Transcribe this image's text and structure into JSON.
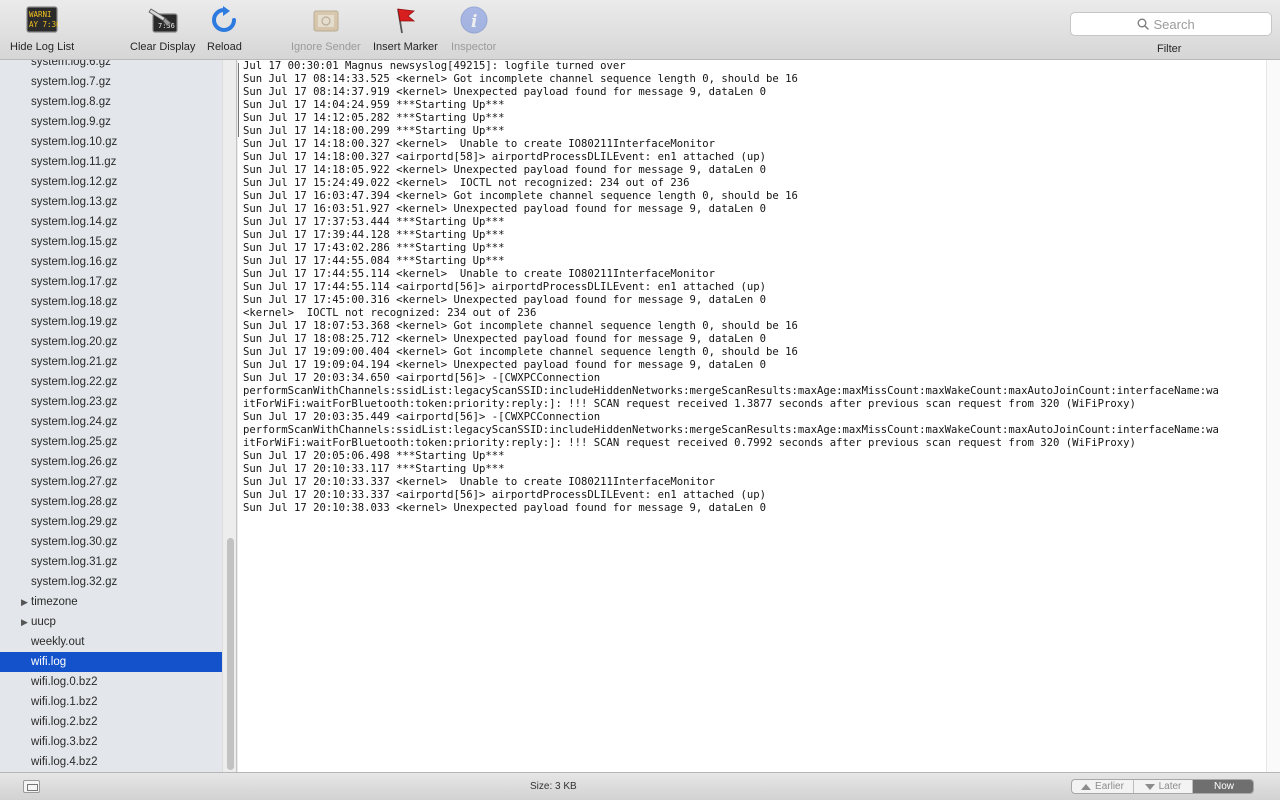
{
  "toolbar": {
    "hide_log_list": "Hide Log List",
    "hide_log_list_icon_text_top": "WARNI",
    "hide_log_list_icon_text_bottom": "AY 7:36",
    "clear_display": "Clear Display",
    "clear_display_icon_text": "7:36",
    "reload": "Reload",
    "ignore_sender": "Ignore Sender",
    "insert_marker": "Insert Marker",
    "inspector": "Inspector",
    "search_placeholder": "Search",
    "filter": "Filter"
  },
  "sidebar": {
    "items": [
      {
        "label": "system.log.6.gz"
      },
      {
        "label": "system.log.7.gz"
      },
      {
        "label": "system.log.8.gz"
      },
      {
        "label": "system.log.9.gz"
      },
      {
        "label": "system.log.10.gz"
      },
      {
        "label": "system.log.11.gz"
      },
      {
        "label": "system.log.12.gz"
      },
      {
        "label": "system.log.13.gz"
      },
      {
        "label": "system.log.14.gz"
      },
      {
        "label": "system.log.15.gz"
      },
      {
        "label": "system.log.16.gz"
      },
      {
        "label": "system.log.17.gz"
      },
      {
        "label": "system.log.18.gz"
      },
      {
        "label": "system.log.19.gz"
      },
      {
        "label": "system.log.20.gz"
      },
      {
        "label": "system.log.21.gz"
      },
      {
        "label": "system.log.22.gz"
      },
      {
        "label": "system.log.23.gz"
      },
      {
        "label": "system.log.24.gz"
      },
      {
        "label": "system.log.25.gz"
      },
      {
        "label": "system.log.26.gz"
      },
      {
        "label": "system.log.27.gz"
      },
      {
        "label": "system.log.28.gz"
      },
      {
        "label": "system.log.29.gz"
      },
      {
        "label": "system.log.30.gz"
      },
      {
        "label": "system.log.31.gz"
      },
      {
        "label": "system.log.32.gz"
      },
      {
        "label": "timezone",
        "folder": true
      },
      {
        "label": "uucp",
        "folder": true
      },
      {
        "label": "weekly.out"
      },
      {
        "label": "wifi.log",
        "selected": true
      },
      {
        "label": "wifi.log.0.bz2"
      },
      {
        "label": "wifi.log.1.bz2"
      },
      {
        "label": "wifi.log.2.bz2"
      },
      {
        "label": "wifi.log.3.bz2"
      },
      {
        "label": "wifi.log.4.bz2"
      }
    ]
  },
  "log": {
    "lines": [
      "Jul 17 00:30:01 Magnus newsyslog[49215]: logfile turned over",
      "Sun Jul 17 08:14:33.525 <kernel> Got incomplete channel sequence length 0, should be 16",
      "Sun Jul 17 08:14:37.919 <kernel> Unexpected payload found for message 9, dataLen 0",
      "Sun Jul 17 14:04:24.959 ***Starting Up***",
      "Sun Jul 17 14:12:05.282 ***Starting Up***",
      "Sun Jul 17 14:18:00.299 ***Starting Up***",
      "Sun Jul 17 14:18:00.327 <kernel>  Unable to create IO80211InterfaceMonitor",
      "Sun Jul 17 14:18:00.327 <airportd[58]> airportdProcessDLILEvent: en1 attached (up)",
      "Sun Jul 17 14:18:05.922 <kernel> Unexpected payload found for message 9, dataLen 0",
      "Sun Jul 17 15:24:49.022 <kernel>  IOCTL not recognized: 234 out of 236",
      "Sun Jul 17 16:03:47.394 <kernel> Got incomplete channel sequence length 0, should be 16",
      "Sun Jul 17 16:03:51.927 <kernel> Unexpected payload found for message 9, dataLen 0",
      "Sun Jul 17 17:37:53.444 ***Starting Up***",
      "Sun Jul 17 17:39:44.128 ***Starting Up***",
      "Sun Jul 17 17:43:02.286 ***Starting Up***",
      "Sun Jul 17 17:44:55.084 ***Starting Up***",
      "Sun Jul 17 17:44:55.114 <kernel>  Unable to create IO80211InterfaceMonitor",
      "Sun Jul 17 17:44:55.114 <airportd[56]> airportdProcessDLILEvent: en1 attached (up)",
      "Sun Jul 17 17:45:00.316 <kernel> Unexpected payload found for message 9, dataLen 0",
      "<kernel>  IOCTL not recognized: 234 out of 236",
      "Sun Jul 17 18:07:53.368 <kernel> Got incomplete channel sequence length 0, should be 16",
      "Sun Jul 17 18:08:25.712 <kernel> Unexpected payload found for message 9, dataLen 0",
      "Sun Jul 17 19:09:00.404 <kernel> Got incomplete channel sequence length 0, should be 16",
      "Sun Jul 17 19:09:04.194 <kernel> Unexpected payload found for message 9, dataLen 0",
      "Sun Jul 17 20:03:34.650 <airportd[56]> -[CWXPCConnection",
      "performScanWithChannels:ssidList:legacyScanSSID:includeHiddenNetworks:mergeScanResults:maxAge:maxMissCount:maxWakeCount:maxAutoJoinCount:interfaceName:wa",
      "itForWiFi:waitForBluetooth:token:priority:reply:]: !!! SCAN request received 1.3877 seconds after previous scan request from 320 (WiFiProxy)",
      "Sun Jul 17 20:03:35.449 <airportd[56]> -[CWXPCConnection",
      "performScanWithChannels:ssidList:legacyScanSSID:includeHiddenNetworks:mergeScanResults:maxAge:maxMissCount:maxWakeCount:maxAutoJoinCount:interfaceName:wa",
      "itForWiFi:waitForBluetooth:token:priority:reply:]: !!! SCAN request received 0.7992 seconds after previous scan request from 320 (WiFiProxy)",
      "Sun Jul 17 20:05:06.498 ***Starting Up***",
      "Sun Jul 17 20:10:33.117 ***Starting Up***",
      "Sun Jul 17 20:10:33.337 <kernel>  Unable to create IO80211InterfaceMonitor",
      "Sun Jul 17 20:10:33.337 <airportd[56]> airportdProcessDLILEvent: en1 attached (up)",
      "Sun Jul 17 20:10:38.033 <kernel> Unexpected payload found for message 9, dataLen 0"
    ]
  },
  "status": {
    "size": "Size: 3 KB",
    "earlier": "Earlier",
    "later": "Later",
    "now": "Now"
  },
  "colors": {
    "selection": "#1452cc",
    "sidebar_bg": "#e3e6ea",
    "inspector_blue": "#5b7de0",
    "marker_red": "#d81e1e"
  }
}
